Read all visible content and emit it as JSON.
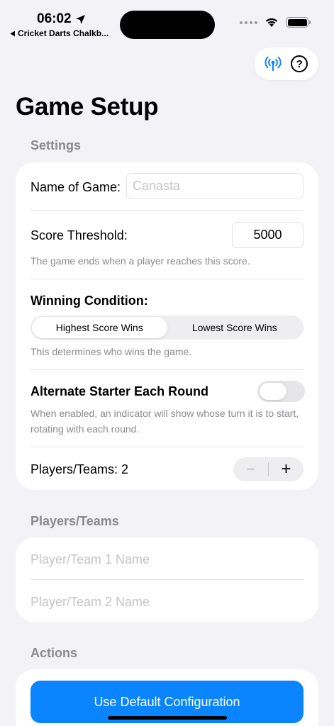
{
  "status_bar": {
    "time": "06:02",
    "back_app": "Cricket Darts Chalkb..."
  },
  "toolbar": {
    "broadcast_icon": "antenna-radiowaves-icon",
    "help_icon": "question-circle-icon",
    "help_symbol": "?"
  },
  "page_title": "Game Setup",
  "settings": {
    "header": "Settings",
    "name_label": "Name of Game:",
    "name_placeholder": "Canasta",
    "threshold_label": "Score Threshold:",
    "threshold_value": "5000",
    "threshold_footnote": "The game ends when a player reaches this score.",
    "winning_label": "Winning Condition:",
    "winning_options": [
      "Highest Score Wins",
      "Lowest Score Wins"
    ],
    "winning_selected": "Highest Score Wins",
    "winning_footnote": "This determines who wins the game.",
    "alternate_label": "Alternate Starter Each Round",
    "alternate_enabled": false,
    "alternate_footnote": "When enabled, an indicator will show whose turn it is to start, rotating with each round.",
    "players_label": "Players/Teams: 2",
    "stepper_minus": "−",
    "stepper_plus": "+"
  },
  "players": {
    "header": "Players/Teams",
    "player1_placeholder": "Player/Team 1 Name",
    "player2_placeholder": "Player/Team 2 Name"
  },
  "actions": {
    "header": "Actions",
    "default_config_label": "Use Default Configuration"
  },
  "colors": {
    "accent": "#0a84ff",
    "background": "#f2f2f7",
    "secondary_text": "#8a8a8e"
  }
}
